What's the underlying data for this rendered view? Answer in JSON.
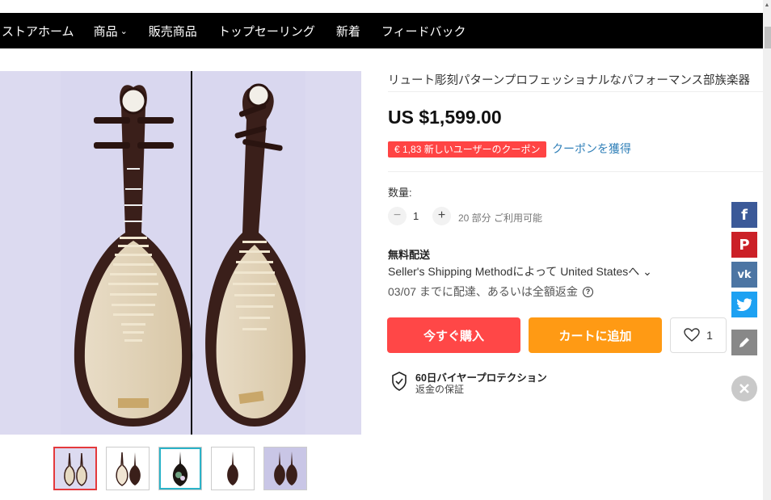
{
  "nav": {
    "items": [
      {
        "label": "ストアホーム"
      },
      {
        "label": "商品",
        "has_dropdown": true
      },
      {
        "label": "販売商品"
      },
      {
        "label": "トップセーリング"
      },
      {
        "label": "新着"
      },
      {
        "label": "フィードバック"
      }
    ]
  },
  "product": {
    "title": "リュート彫刻パターンプロフェッショナルなパフォーマンス部族楽器",
    "price": "US $1,599.00",
    "coupon_badge": "€ 1,83 新しいユーザーのクーポン",
    "coupon_link": "クーポンを獲得",
    "quantity_label": "数量:",
    "quantity_value": "1",
    "quantity_available": "20 部分 ご利用可能",
    "shipping_title": "無料配送",
    "shipping_method": "Seller's Shipping Methodによって United Statesへ ⌄",
    "delivery_date": "03/07 までに配達、あるいは全額返金",
    "buy_now": "今すぐ購入",
    "add_to_cart": "カートに追加",
    "wishlist_count": "1",
    "protection_title": "60日バイヤープロテクション",
    "protection_sub": "返金の保証"
  },
  "images": {
    "main_background": "#d9d7ef",
    "thumbnails": [
      {
        "name": "pipa-front-back",
        "active": true
      },
      {
        "name": "pipa-dark-pair"
      },
      {
        "name": "pipa-inlay"
      },
      {
        "name": "pipa-dark-single"
      },
      {
        "name": "pipa-pair-purple"
      }
    ]
  },
  "social": [
    "facebook-icon",
    "pinterest-icon",
    "vk-icon",
    "twitter-icon",
    "edit-icon",
    "close-icon"
  ],
  "colors": {
    "buy": "#ff4747",
    "cart": "#ff9a14",
    "coupon": "#f44",
    "link": "#2f7fb8"
  }
}
